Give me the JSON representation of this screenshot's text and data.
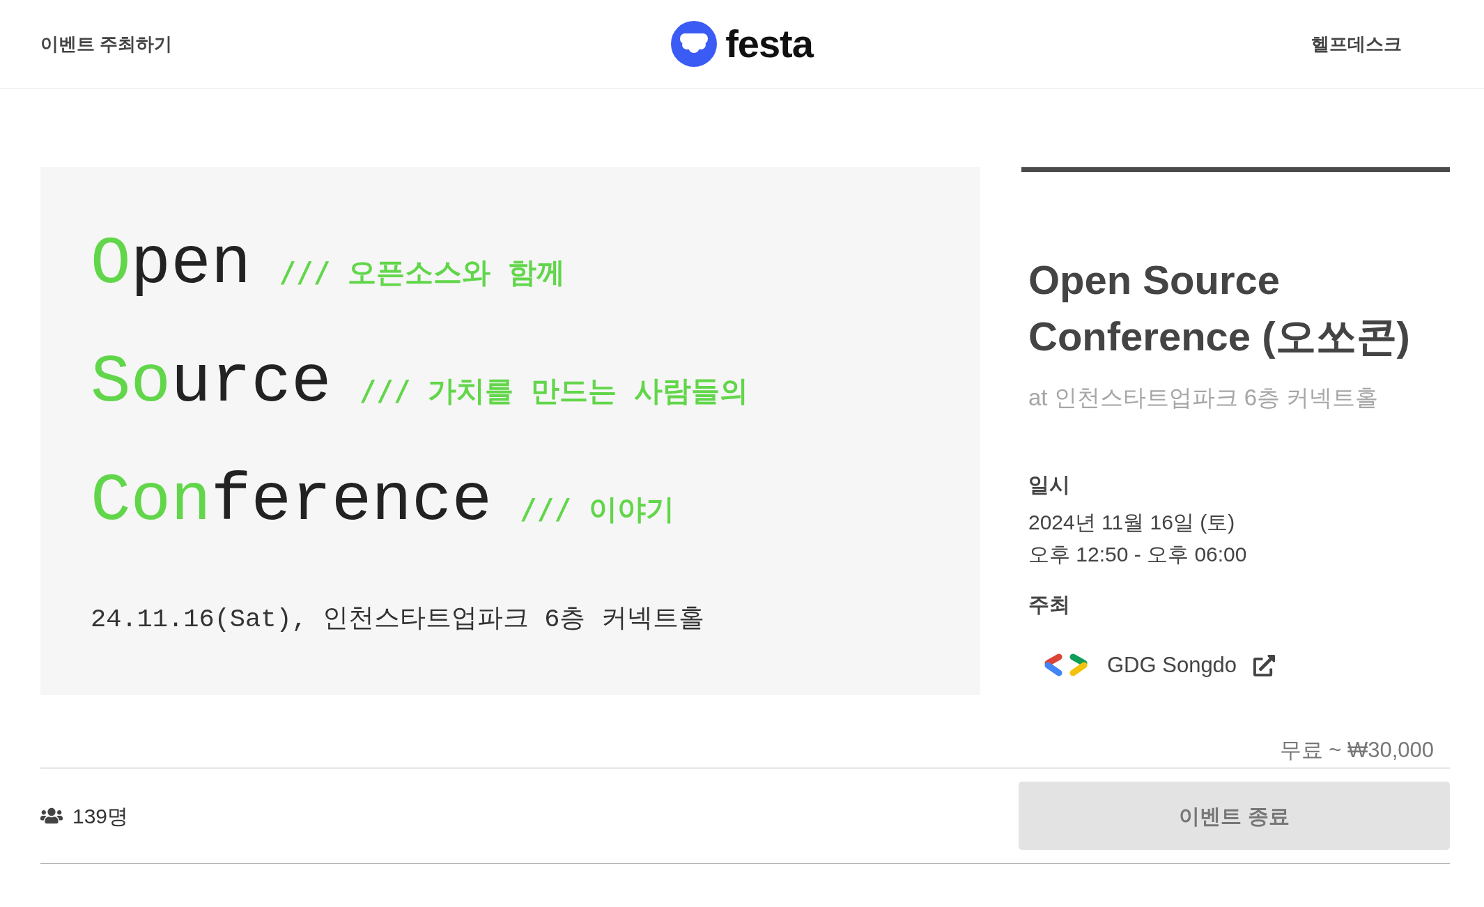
{
  "header": {
    "host_link": "이벤트 주최하기",
    "logo": "festa",
    "help_link": "헬프데스크"
  },
  "banner": {
    "lines": [
      {
        "accent": "O",
        "rest": "pen",
        "tagline": "/// 오픈소스와 함께"
      },
      {
        "accent": "So",
        "rest": "urce",
        "tagline": "/// 가치를 만드는 사람들의"
      },
      {
        "accent": "Con",
        "rest": "ference",
        "tagline": "/// 이야기"
      }
    ],
    "footer": "24.11.16(Sat), 인천스타트업파크 6층 커넥트홀"
  },
  "event": {
    "title": "Open Source Conference (오쏘콘)",
    "venue": "at 인천스타트업파크 6층 커넥트홀",
    "sections": [
      {
        "kind": "schedule",
        "heading": "일시",
        "lines": [
          "2024년 11월 16일 (토)",
          "오후 12:50 - 오후 06:00"
        ]
      },
      {
        "kind": "host",
        "heading": "주최",
        "name": "GDG Songdo"
      }
    ],
    "price": "무료 ~ ₩30,000"
  },
  "footer": {
    "attendees": "139명",
    "button": {
      "label": "이벤트 종료",
      "disabled": true
    }
  }
}
